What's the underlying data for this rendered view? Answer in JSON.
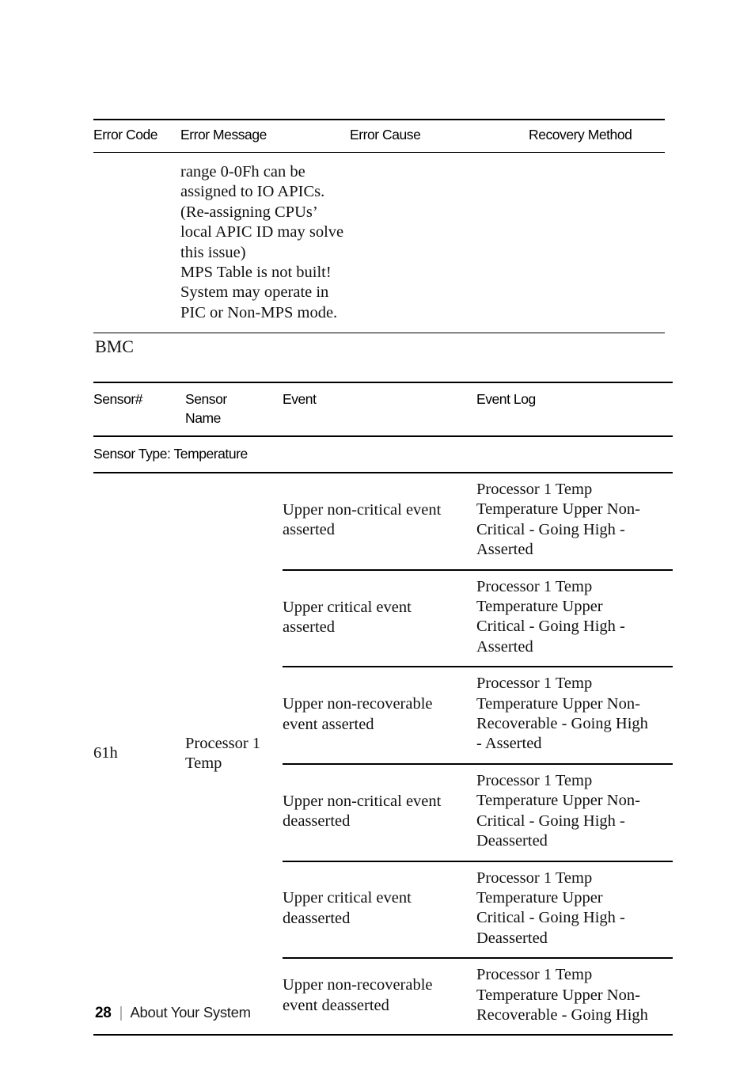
{
  "error_table": {
    "headers": [
      "Error Code",
      "Error Message",
      "Error Cause",
      "Recovery Method"
    ],
    "rows": [
      {
        "error_code": "",
        "error_message_lines": [
          "range 0-0Fh can be",
          "assigned to IO APICs.",
          "(Re-assigning CPUs’",
          "local APIC ID may solve",
          "this issue)",
          "MPS Table is not built!",
          "System may operate in",
          "PIC or Non-MPS mode."
        ],
        "error_cause": "",
        "recovery_method": ""
      }
    ]
  },
  "bmc_section": {
    "caption": "BMC",
    "headers": {
      "sensor_num": "Sensor#",
      "sensor_name_line1": "Sensor",
      "sensor_name_line2": "Name",
      "event": "Event",
      "event_log": "Event Log"
    },
    "group_header": "Sensor Type: Temperature",
    "sensor_num": "61h",
    "sensor_name_line1": "Processor 1",
    "sensor_name_line2": "Temp",
    "rows": [
      {
        "event_lines": [
          "Upper non-critical event",
          "asserted"
        ],
        "event_log_lines": [
          "Processor 1 Temp",
          "Temperature Upper Non-",
          "Critical - Going High -",
          "Asserted"
        ]
      },
      {
        "event_lines": [
          "Upper critical event",
          "asserted"
        ],
        "event_log_lines": [
          "Processor 1 Temp",
          "Temperature Upper",
          "Critical - Going High -",
          "Asserted"
        ]
      },
      {
        "event_lines": [
          "Upper non-recoverable",
          "event asserted"
        ],
        "event_log_lines": [
          "Processor 1 Temp",
          "Temperature Upper Non-",
          "Recoverable - Going High",
          "- Asserted"
        ]
      },
      {
        "event_lines": [
          "Upper non-critical event",
          "deasserted"
        ],
        "event_log_lines": [
          "Processor 1 Temp",
          "Temperature Upper Non-",
          "Critical - Going High -",
          "Deasserted"
        ]
      },
      {
        "event_lines": [
          "Upper critical event",
          "deasserted"
        ],
        "event_log_lines": [
          "Processor 1 Temp",
          "Temperature Upper",
          "Critical - Going High -",
          "Deasserted"
        ]
      },
      {
        "event_lines": [
          "Upper non-recoverable",
          "event deasserted"
        ],
        "event_log_lines": [
          "Processor 1 Temp",
          "Temperature Upper Non-",
          "Recoverable - Going High"
        ]
      }
    ]
  },
  "footer": {
    "page_number": "28",
    "separator": "|",
    "section_title": "About Your System"
  }
}
